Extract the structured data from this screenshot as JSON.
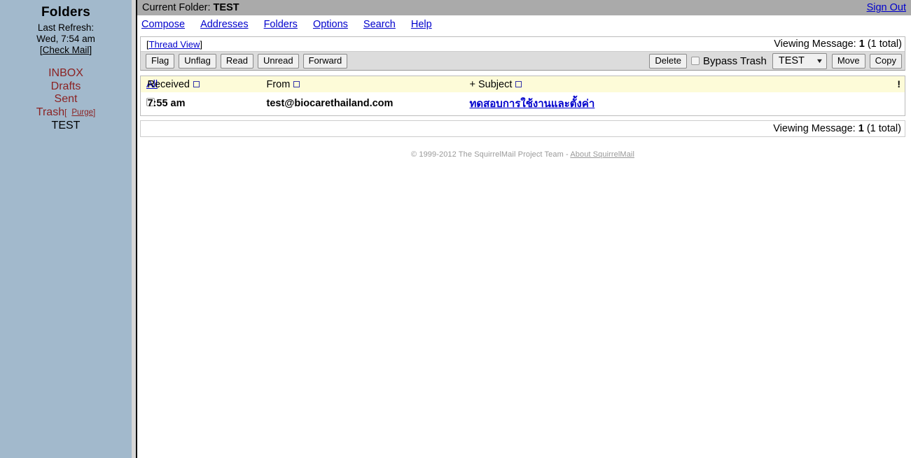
{
  "sidebar": {
    "title": "Folders",
    "last_refresh_label": "Last Refresh:",
    "last_refresh_value": "Wed, 7:54 am",
    "check_mail_open": "[",
    "check_mail_label": "Check Mail",
    "check_mail_close": "]",
    "folders": [
      {
        "label": "INBOX",
        "current": false
      },
      {
        "label": "Drafts",
        "current": false
      },
      {
        "label": "Sent",
        "current": false
      },
      {
        "label": "Trash",
        "current": false,
        "purge_open": "[",
        "purge_label": "Purge",
        "purge_close": "]"
      },
      {
        "label": "TEST",
        "current": true
      }
    ],
    "bg_color": "#a2b9cc",
    "link_color": "#8b2323"
  },
  "topbar": {
    "current_folder_label": "Current Folder:",
    "current_folder_value": "TEST",
    "sign_out_label": "Sign Out",
    "bg_color": "#aaaaaa",
    "link_color": "#0000cc"
  },
  "menubar": {
    "items": [
      {
        "label": "Compose"
      },
      {
        "label": "Addresses"
      },
      {
        "label": "Folders"
      },
      {
        "label": "Options"
      },
      {
        "label": "Search"
      },
      {
        "label": "Help"
      }
    ]
  },
  "panel": {
    "thread_view_open": "[",
    "thread_view_label": "Thread View",
    "thread_view_close": "]",
    "viewing_prefix": "Viewing Message:",
    "viewing_number": "1",
    "viewing_total": "(1 total)",
    "buttons_left": [
      {
        "label": "Flag",
        "name": "flag-button"
      },
      {
        "label": "Unflag",
        "name": "unflag-button"
      },
      {
        "label": "Read",
        "name": "read-button"
      },
      {
        "label": "Unread",
        "name": "unread-button"
      },
      {
        "label": "Forward",
        "name": "forward-button"
      }
    ],
    "delete_label": "Delete",
    "bypass_trash_label": "Bypass Trash",
    "bypass_trash_checked": false,
    "folder_select_value": "TEST",
    "move_label": "Move",
    "copy_label": "Copy",
    "toolbar_bg": "#dcdcdc"
  },
  "message_table": {
    "header_bg": "#fdfbd8",
    "columns": {
      "all_label": "All",
      "received_label": "Received",
      "from_label": "From",
      "subject_prefix": "+",
      "subject_label": "Subject",
      "flag_label": "!"
    },
    "rows": [
      {
        "checked": false,
        "date": "7:55 am",
        "from": "test@biocarethailand.com",
        "subject": "ทดสอบการใช้งานและตั้งค่า",
        "flag": ""
      }
    ]
  },
  "bottom_bar": {
    "viewing_prefix": "Viewing Message:",
    "viewing_number": "1",
    "viewing_total": "(1 total)"
  },
  "footer": {
    "copyright": "© 1999-2012 The SquirrelMail Project Team -",
    "about_label": "About SquirrelMail"
  }
}
